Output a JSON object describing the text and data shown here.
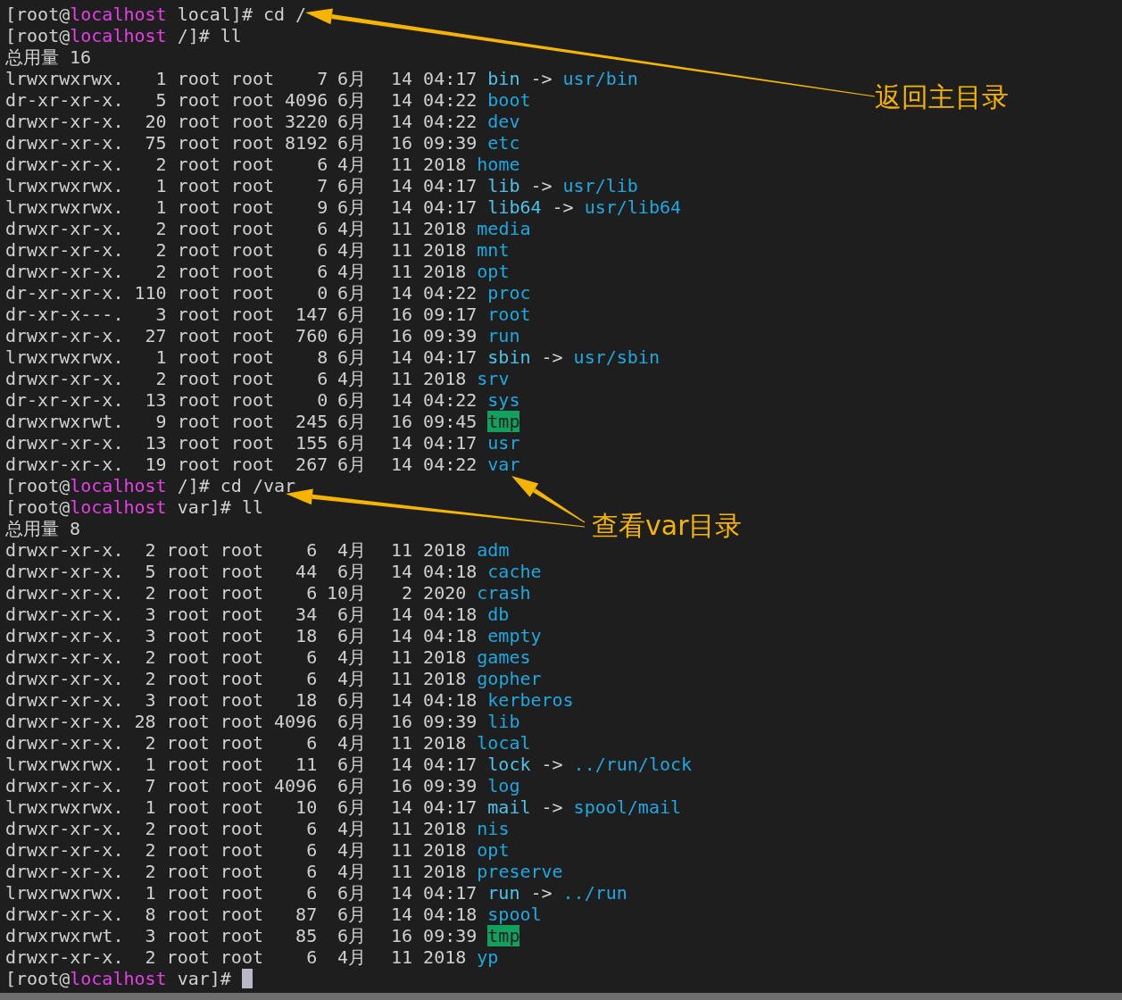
{
  "terminal": {
    "lines": [
      {
        "kind": "prompt",
        "before": "[root@",
        "host": "localhost",
        "after": " local]# cd /",
        "cursor": false
      },
      {
        "kind": "prompt",
        "before": "[root@",
        "host": "localhost",
        "after": " /]# ll",
        "cursor": false
      },
      {
        "kind": "total",
        "text": "总用量 16"
      },
      {
        "kind": "entry",
        "info": "lrwxrwxrwx.   1 root root    7",
        "month": "6月",
        "stamp": "14 04:17",
        "file": {
          "kind": "link",
          "name": "bin",
          "arrow": "->",
          "target": "usr/bin"
        }
      },
      {
        "kind": "entry",
        "info": "dr-xr-xr-x.   5 root root 4096",
        "month": "6月",
        "stamp": "14 04:22",
        "file": {
          "kind": "dir",
          "name": "boot"
        }
      },
      {
        "kind": "entry",
        "info": "drwxr-xr-x.  20 root root 3220",
        "month": "6月",
        "stamp": "14 04:22",
        "file": {
          "kind": "dir",
          "name": "dev"
        }
      },
      {
        "kind": "entry",
        "info": "drwxr-xr-x.  75 root root 8192",
        "month": "6月",
        "stamp": "16 09:39",
        "file": {
          "kind": "dir",
          "name": "etc"
        }
      },
      {
        "kind": "entry",
        "info": "drwxr-xr-x.   2 root root    6",
        "month": "4月",
        "stamp": "11 2018",
        "file": {
          "kind": "dir",
          "name": "home"
        }
      },
      {
        "kind": "entry",
        "info": "lrwxrwxrwx.   1 root root    7",
        "month": "6月",
        "stamp": "14 04:17",
        "file": {
          "kind": "link",
          "name": "lib",
          "arrow": "->",
          "target": "usr/lib"
        }
      },
      {
        "kind": "entry",
        "info": "lrwxrwxrwx.   1 root root    9",
        "month": "6月",
        "stamp": "14 04:17",
        "file": {
          "kind": "link",
          "name": "lib64",
          "arrow": "->",
          "target": "usr/lib64"
        }
      },
      {
        "kind": "entry",
        "info": "drwxr-xr-x.   2 root root    6",
        "month": "4月",
        "stamp": "11 2018",
        "file": {
          "kind": "dir",
          "name": "media"
        }
      },
      {
        "kind": "entry",
        "info": "drwxr-xr-x.   2 root root    6",
        "month": "4月",
        "stamp": "11 2018",
        "file": {
          "kind": "dir",
          "name": "mnt"
        }
      },
      {
        "kind": "entry",
        "info": "drwxr-xr-x.   2 root root    6",
        "month": "4月",
        "stamp": "11 2018",
        "file": {
          "kind": "dir",
          "name": "opt"
        }
      },
      {
        "kind": "entry",
        "info": "dr-xr-xr-x. 110 root root    0",
        "month": "6月",
        "stamp": "14 04:22",
        "file": {
          "kind": "dir",
          "name": "proc"
        }
      },
      {
        "kind": "entry",
        "info": "dr-xr-x---.   3 root root  147",
        "month": "6月",
        "stamp": "16 09:17",
        "file": {
          "kind": "dir",
          "name": "root"
        }
      },
      {
        "kind": "entry",
        "info": "drwxr-xr-x.  27 root root  760",
        "month": "6月",
        "stamp": "16 09:39",
        "file": {
          "kind": "dir",
          "name": "run"
        }
      },
      {
        "kind": "entry",
        "info": "lrwxrwxrwx.   1 root root    8",
        "month": "6月",
        "stamp": "14 04:17",
        "file": {
          "kind": "link",
          "name": "sbin",
          "arrow": "->",
          "target": "usr/sbin"
        }
      },
      {
        "kind": "entry",
        "info": "drwxr-xr-x.   2 root root    6",
        "month": "4月",
        "stamp": "11 2018",
        "file": {
          "kind": "dir",
          "name": "srv"
        }
      },
      {
        "kind": "entry",
        "info": "dr-xr-xr-x.  13 root root    0",
        "month": "6月",
        "stamp": "14 04:22",
        "file": {
          "kind": "dir",
          "name": "sys"
        }
      },
      {
        "kind": "entry",
        "info": "drwxrwxrwt.   9 root root  245",
        "month": "6月",
        "stamp": "16 09:45",
        "file": {
          "kind": "sticky",
          "name": "tmp"
        }
      },
      {
        "kind": "entry",
        "info": "drwxr-xr-x.  13 root root  155",
        "month": "6月",
        "stamp": "14 04:17",
        "file": {
          "kind": "dir",
          "name": "usr"
        }
      },
      {
        "kind": "entry",
        "info": "drwxr-xr-x.  19 root root  267",
        "month": "6月",
        "stamp": "14 04:22",
        "file": {
          "kind": "dir",
          "name": "var"
        }
      },
      {
        "kind": "prompt",
        "before": "[root@",
        "host": "localhost",
        "after": " /]# cd /var",
        "cursor": false
      },
      {
        "kind": "prompt",
        "before": "[root@",
        "host": "localhost",
        "after": " var]# ll",
        "cursor": false
      },
      {
        "kind": "total",
        "text": "总用量 8"
      },
      {
        "kind": "entry",
        "info": "drwxr-xr-x.  2 root root    6",
        "month": "4月",
        "stamp": "11 2018",
        "file": {
          "kind": "dir",
          "name": "adm"
        }
      },
      {
        "kind": "entry",
        "info": "drwxr-xr-x.  5 root root   44",
        "month": "6月",
        "stamp": "14 04:18",
        "file": {
          "kind": "dir",
          "name": "cache"
        }
      },
      {
        "kind": "entry",
        "info": "drwxr-xr-x.  2 root root    6",
        "month": "10月",
        "stamp": " 2 2020",
        "file": {
          "kind": "dir",
          "name": "crash"
        }
      },
      {
        "kind": "entry",
        "info": "drwxr-xr-x.  3 root root   34",
        "month": "6月",
        "stamp": "14 04:18",
        "file": {
          "kind": "dir",
          "name": "db"
        }
      },
      {
        "kind": "entry",
        "info": "drwxr-xr-x.  3 root root   18",
        "month": "6月",
        "stamp": "14 04:18",
        "file": {
          "kind": "dir",
          "name": "empty"
        }
      },
      {
        "kind": "entry",
        "info": "drwxr-xr-x.  2 root root    6",
        "month": "4月",
        "stamp": "11 2018",
        "file": {
          "kind": "dir",
          "name": "games"
        }
      },
      {
        "kind": "entry",
        "info": "drwxr-xr-x.  2 root root    6",
        "month": "4月",
        "stamp": "11 2018",
        "file": {
          "kind": "dir",
          "name": "gopher"
        }
      },
      {
        "kind": "entry",
        "info": "drwxr-xr-x.  3 root root   18",
        "month": "6月",
        "stamp": "14 04:18",
        "file": {
          "kind": "dir",
          "name": "kerberos"
        }
      },
      {
        "kind": "entry",
        "info": "drwxr-xr-x. 28 root root 4096",
        "month": "6月",
        "stamp": "16 09:39",
        "file": {
          "kind": "dir",
          "name": "lib"
        }
      },
      {
        "kind": "entry",
        "info": "drwxr-xr-x.  2 root root    6",
        "month": "4月",
        "stamp": "11 2018",
        "file": {
          "kind": "dir",
          "name": "local"
        }
      },
      {
        "kind": "entry",
        "info": "lrwxrwxrwx.  1 root root   11",
        "month": "6月",
        "stamp": "14 04:17",
        "file": {
          "kind": "link",
          "name": "lock",
          "arrow": "->",
          "target": "../run/lock"
        }
      },
      {
        "kind": "entry",
        "info": "drwxr-xr-x.  7 root root 4096",
        "month": "6月",
        "stamp": "16 09:39",
        "file": {
          "kind": "dir",
          "name": "log"
        }
      },
      {
        "kind": "entry",
        "info": "lrwxrwxrwx.  1 root root   10",
        "month": "6月",
        "stamp": "14 04:17",
        "file": {
          "kind": "link",
          "name": "mail",
          "arrow": "->",
          "target": "spool/mail"
        }
      },
      {
        "kind": "entry",
        "info": "drwxr-xr-x.  2 root root    6",
        "month": "4月",
        "stamp": "11 2018",
        "file": {
          "kind": "dir",
          "name": "nis"
        }
      },
      {
        "kind": "entry",
        "info": "drwxr-xr-x.  2 root root    6",
        "month": "4月",
        "stamp": "11 2018",
        "file": {
          "kind": "dir",
          "name": "opt"
        }
      },
      {
        "kind": "entry",
        "info": "drwxr-xr-x.  2 root root    6",
        "month": "4月",
        "stamp": "11 2018",
        "file": {
          "kind": "dir",
          "name": "preserve"
        }
      },
      {
        "kind": "entry",
        "info": "lrwxrwxrwx.  1 root root    6",
        "month": "6月",
        "stamp": "14 04:17",
        "file": {
          "kind": "link",
          "name": "run",
          "arrow": "->",
          "target": "../run"
        }
      },
      {
        "kind": "entry",
        "info": "drwxr-xr-x.  8 root root   87",
        "month": "6月",
        "stamp": "14 04:18",
        "file": {
          "kind": "dir",
          "name": "spool"
        }
      },
      {
        "kind": "entry",
        "info": "drwxrwxrwt.  3 root root   85",
        "month": "6月",
        "stamp": "16 09:39",
        "file": {
          "kind": "sticky",
          "name": "tmp"
        }
      },
      {
        "kind": "entry",
        "info": "drwxr-xr-x.  2 root root    6",
        "month": "4月",
        "stamp": "11 2018",
        "file": {
          "kind": "dir",
          "name": "yp"
        }
      },
      {
        "kind": "prompt",
        "before": "[root@",
        "host": "localhost",
        "after": " var]# ",
        "cursor": true
      }
    ]
  },
  "annotations": [
    {
      "text": "返回主目录"
    },
    {
      "text": "查看var目录"
    }
  ]
}
